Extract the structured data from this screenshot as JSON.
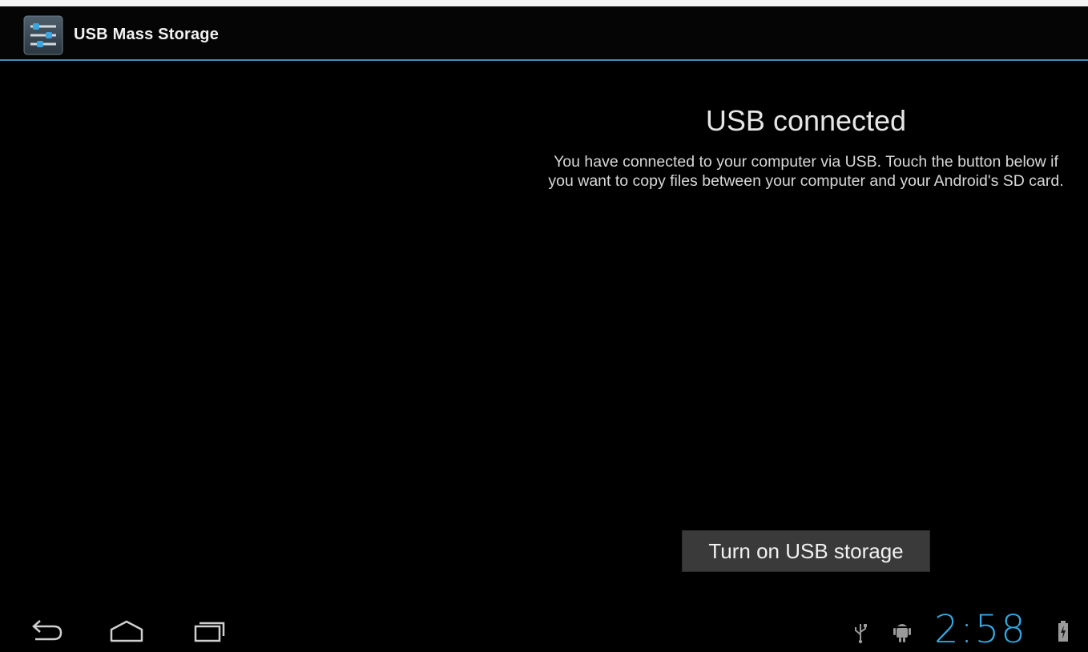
{
  "action_bar": {
    "title": "USB Mass Storage",
    "icon": "settings-sliders-icon"
  },
  "content": {
    "heading": "USB connected",
    "description": "You have connected to your computer via USB. Touch the button below if you want to copy files between your computer and your Android's SD card."
  },
  "button": {
    "label": "Turn on USB storage"
  },
  "navigation_bar": {
    "buttons": [
      "back-icon",
      "home-icon",
      "recent-apps-icon"
    ]
  },
  "status_bar": {
    "icons": [
      "usb-icon",
      "android-debug-icon",
      "battery-charging-icon"
    ],
    "time": "2:58"
  },
  "colors": {
    "background": "#000000",
    "accent": "#33a7e0",
    "divider": "#3f8fb8",
    "button_bg": "#3a3a3a"
  }
}
